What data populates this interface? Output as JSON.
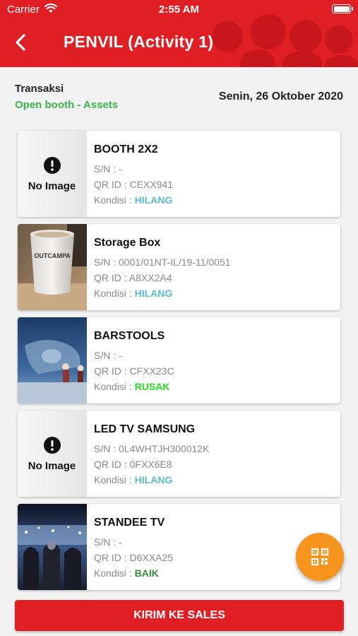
{
  "status_bar": {
    "carrier": "Carrier",
    "time": "2:55 AM"
  },
  "header": {
    "title": "PENVIL (Activity 1)",
    "back_icon": "chevron-left-icon"
  },
  "info": {
    "label": "Transaksi",
    "type": "Open booth - Assets",
    "date": "Senin, 26 Oktober 2020"
  },
  "items": [
    {
      "name": "BOOTH 2X2",
      "sn": "S/N : -",
      "qr": "QR ID : CEXX941",
      "condition_label": "Kondisi : ",
      "condition": "HILANG",
      "condition_color": "#5bb8d0",
      "image": "No Image"
    },
    {
      "name": "Storage Box",
      "sn": "S/N : 0001/01NT-IL/19-11/0051",
      "qr": "QR ID : A8XX2A4",
      "condition_label": "Kondisi : ",
      "condition": "HILANG",
      "condition_color": "#5bb8d0",
      "image_text": "OUTCAMPA"
    },
    {
      "name": "BARSTOOLS",
      "sn": "S/N : -",
      "qr": "QR ID : CFXX23C",
      "condition_label": "Kondisi : ",
      "condition": "RUSAK",
      "condition_color": "#22dd22"
    },
    {
      "name": "LED TV SAMSUNG",
      "sn": "S/N : 0L4WHTJH300012K",
      "qr": "QR ID : 0FXX6E8",
      "condition_label": "Kondisi : ",
      "condition": "HILANG",
      "condition_color": "#5bb8d0",
      "image": "No Image"
    },
    {
      "name": "STANDEE TV",
      "sn": "S/N : -",
      "qr": "QR ID : D6XXA25",
      "condition_label": "Kondisi : ",
      "condition": "BAIK",
      "condition_color": "#3a8a3a"
    }
  ],
  "fab": {
    "icon": "qr-code-icon",
    "color": "#f7941d"
  },
  "footer": {
    "send_label": "KIRIM KE SALES"
  },
  "colors": {
    "primary": "#e01f25"
  }
}
